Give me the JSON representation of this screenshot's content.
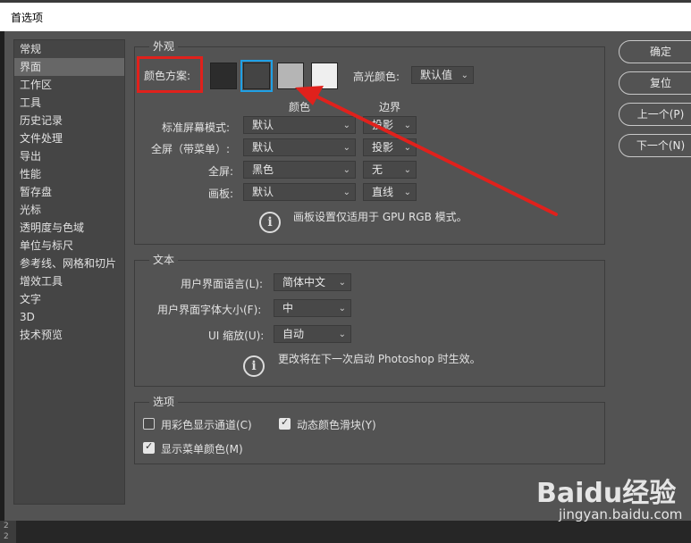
{
  "window": {
    "title": "首选项"
  },
  "sidebar": {
    "items": [
      {
        "label": "常规"
      },
      {
        "label": "界面"
      },
      {
        "label": "工作区"
      },
      {
        "label": "工具"
      },
      {
        "label": "历史记录"
      },
      {
        "label": "文件处理"
      },
      {
        "label": "导出"
      },
      {
        "label": "性能"
      },
      {
        "label": "暂存盘"
      },
      {
        "label": "光标"
      },
      {
        "label": "透明度与色域"
      },
      {
        "label": "单位与标尺"
      },
      {
        "label": "参考线、网格和切片"
      },
      {
        "label": "增效工具"
      },
      {
        "label": "文字"
      },
      {
        "label": "3D"
      },
      {
        "label": "技术预览"
      }
    ],
    "active_index": 1
  },
  "appearance": {
    "group_title": "外观",
    "color_scheme_label": "颜色方案:",
    "swatches": [
      {
        "name": "darkest",
        "color": "#2c2c2c"
      },
      {
        "name": "dark",
        "color": "#444444",
        "selected": true
      },
      {
        "name": "medium",
        "color": "#b5b5b5"
      },
      {
        "name": "light",
        "color": "#efefef"
      }
    ],
    "highlight_color_label": "高光颜色:",
    "highlight_color_value": "默认值",
    "col_color": "颜色",
    "col_border": "边界",
    "rows": [
      {
        "label": "标准屏幕模式:",
        "color": "默认",
        "border": "投影"
      },
      {
        "label": "全屏（带菜单）:",
        "color": "默认",
        "border": "投影"
      },
      {
        "label": "全屏:",
        "color": "黑色",
        "border": "无"
      },
      {
        "label": "画板:",
        "color": "默认",
        "border": "直线"
      }
    ],
    "info": "画板设置仅适用于 GPU RGB 模式。"
  },
  "text_group": {
    "group_title": "文本",
    "ui_language_label": "用户界面语言(L):",
    "ui_language_value": "简体中文",
    "ui_font_size_label": "用户界面字体大小(F):",
    "ui_font_size_value": "中",
    "ui_scale_label": "UI 缩放(U):",
    "ui_scale_value": "自动",
    "info": "更改将在下一次启动 Photoshop 时生效。"
  },
  "options": {
    "group_title": "选项",
    "show_channels_color": {
      "label": "用彩色显示通道(C)",
      "checked": false
    },
    "dynamic_color_sliders": {
      "label": "动态颜色滑块(Y)",
      "checked": true
    },
    "show_menu_colors": {
      "label": "显示菜单颜色(M)",
      "checked": true
    }
  },
  "buttons": {
    "ok": "确定",
    "reset": "复位",
    "prev": "上一个(P)",
    "next": "下一个(N)"
  },
  "gutter": {
    "line1": "2",
    "line2": "2"
  },
  "watermark": {
    "brand": "Baidu经验",
    "url": "jingyan.baidu.com"
  },
  "colors": {
    "accent": "#1fa0e6",
    "annotation_red": "#e0211c",
    "dialog_bg": "#535353"
  }
}
